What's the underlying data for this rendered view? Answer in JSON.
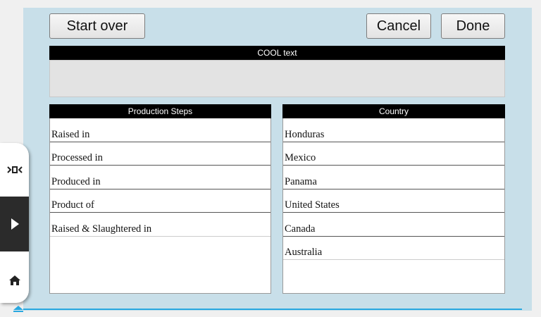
{
  "toolbar": {
    "start_over_label": "Start over",
    "cancel_label": "Cancel",
    "done_label": "Done"
  },
  "cool": {
    "header": "COOL text",
    "value": ""
  },
  "production_steps": {
    "header": "Production Steps",
    "items": [
      "Raised in",
      "Processed in",
      "Produced in",
      "Product of",
      "Raised & Slaughtered in"
    ]
  },
  "country": {
    "header": "Country",
    "items": [
      "Honduras",
      "Mexico",
      "Panama",
      "United States",
      "Canada",
      "Australia"
    ]
  },
  "side_tab": {
    "icons": [
      "collapse-arrows-icon",
      "play-icon",
      "home-icon"
    ]
  },
  "colors": {
    "panel_background": "#c8dfe9",
    "header_background": "#000000",
    "accent_line": "#29a8e0"
  }
}
